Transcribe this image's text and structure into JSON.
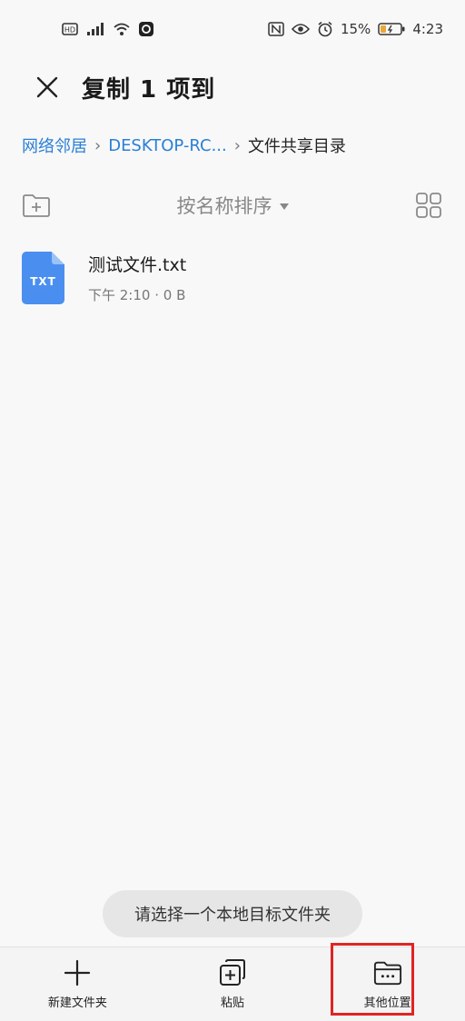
{
  "status_bar": {
    "battery_percent": "15%",
    "time": "4:23",
    "icons": [
      "hd-icon",
      "signal-icon",
      "wifi-icon",
      "app-icon",
      "nfc-icon",
      "eye-icon",
      "alarm-icon",
      "battery-icon"
    ]
  },
  "header": {
    "title": "复制 1 项到"
  },
  "breadcrumb": {
    "items": [
      {
        "label": "网络邻居"
      },
      {
        "label": "DESKTOP-RC..."
      },
      {
        "label": "文件共享目录"
      }
    ]
  },
  "toolbar": {
    "sort_label": "按名称排序"
  },
  "files": [
    {
      "name": "测试文件.txt",
      "ext": "TXT",
      "meta": "下午 2:10 · 0 B"
    }
  ],
  "toast": {
    "message": "请选择一个本地目标文件夹"
  },
  "bottom_bar": {
    "actions": [
      {
        "label": "新建文件夹"
      },
      {
        "label": "粘贴"
      },
      {
        "label": "其他位置"
      }
    ]
  },
  "colors": {
    "link": "#2a7fd6",
    "file_icon": "#4a8ff0",
    "highlight": "#e02424"
  }
}
